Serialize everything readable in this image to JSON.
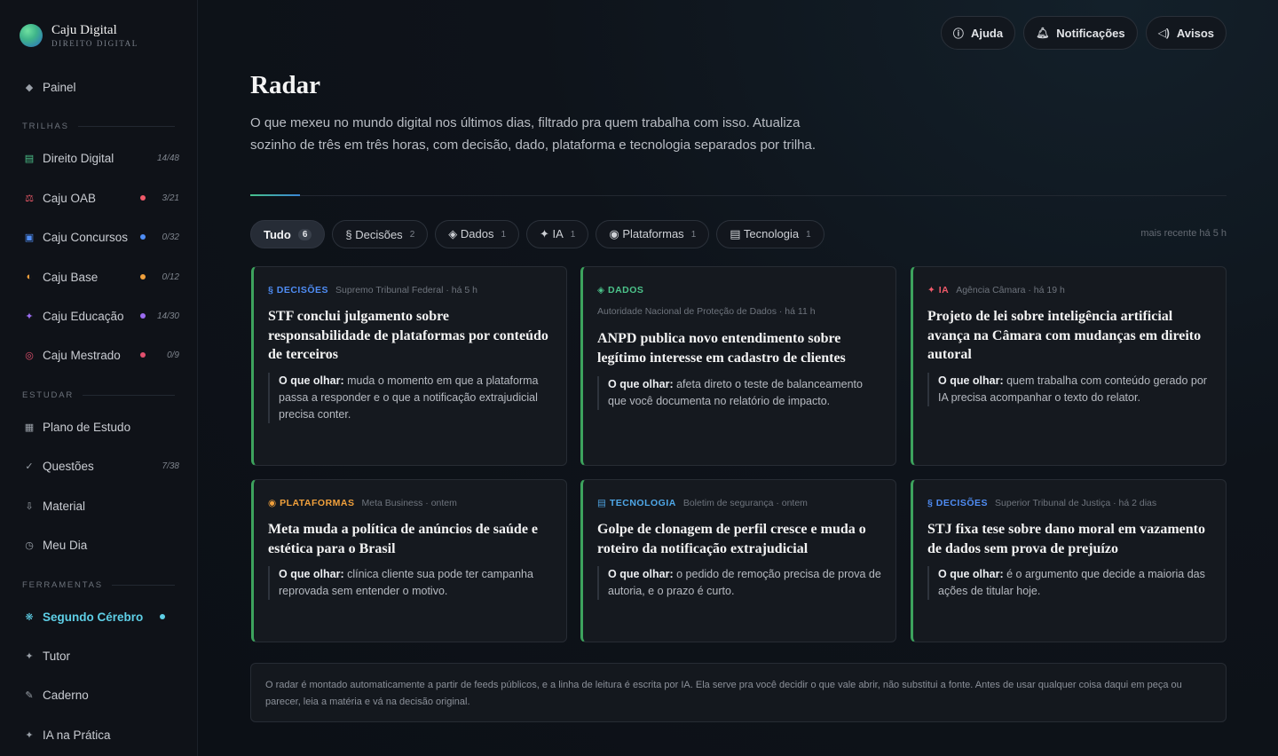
{
  "brand": {
    "name": "Caju Digital",
    "subtitle": "DIREITO DIGITAL"
  },
  "sidebar": {
    "painel": "Painel",
    "sections": [
      "TRILHAS",
      "ESTUDAR",
      "FERRAMENTAS"
    ],
    "trilhas": [
      {
        "label": "Direito Digital",
        "count": "14/48",
        "icon": "book-icon",
        "color": "#4cc38a"
      },
      {
        "label": "Caju OAB",
        "count": "3/21",
        "icon": "scales-icon",
        "color": "#f05a6a"
      },
      {
        "label": "Caju Concursos",
        "count": "0/32",
        "icon": "building-icon",
        "color": "#4f8df5"
      },
      {
        "label": "Caju Base",
        "count": "0/12",
        "icon": "half-circle-icon",
        "color": "#f0a03c"
      },
      {
        "label": "Caju Educação",
        "count": "14/30",
        "icon": "sparkle-icon",
        "color": "#9b6cf0"
      },
      {
        "label": "Caju Mestrado",
        "count": "0/9",
        "icon": "target-icon",
        "color": "#e2506e"
      }
    ],
    "estudar": [
      {
        "label": "Plano de Estudo",
        "count": ""
      },
      {
        "label": "Questões",
        "count": "7/38"
      },
      {
        "label": "Material",
        "count": ""
      },
      {
        "label": "Meu Dia",
        "count": ""
      }
    ],
    "ferramentas": [
      {
        "label": "Segundo Cérebro",
        "active": true
      },
      {
        "label": "Tutor"
      },
      {
        "label": "Caderno"
      },
      {
        "label": "IA na Prática"
      }
    ]
  },
  "topbar": {
    "help": "Ajuda",
    "notifications": "Notificações",
    "notices": "Avisos"
  },
  "page": {
    "title": "Radar",
    "description": "O que mexeu no mundo digital nos últimos dias, filtrado pra quem trabalha com isso. Atualiza sozinho de três em três horas, com decisão, dado, plataforma e tecnologia separados por trilha."
  },
  "filters": [
    {
      "label": "Tudo",
      "count": "6",
      "active": true
    },
    {
      "label": "§ Decisões",
      "count": "2"
    },
    {
      "label": "◈ Dados",
      "count": "1"
    },
    {
      "label": "✦ IA",
      "count": "1"
    },
    {
      "label": "◉ Plataformas",
      "count": "1"
    },
    {
      "label": "▤ Tecnologia",
      "count": "1"
    }
  ],
  "recent": "mais recente há 5 h",
  "cards": [
    {
      "tag": "§ DECISÕES",
      "tag_color": "#4f8df5",
      "source": "Supremo Tribunal Federal · há 5 h",
      "title": "STF conclui julgamento sobre responsabilidade de plataformas por conteúdo de terceiros",
      "look_label": "O que olhar:",
      "look": "muda o momento em que a plataforma passa a responder e o que a notificação extrajudicial precisa conter."
    },
    {
      "tag": "◈ DADOS",
      "tag_color": "#4cc38a",
      "source": "Autoridade Nacional de Proteção de Dados · há 11 h",
      "title": "ANPD publica novo entendimento sobre legítimo interesse em cadastro de clientes",
      "look_label": "O que olhar:",
      "look": "afeta direto o teste de balanceamento que você documenta no relatório de impacto."
    },
    {
      "tag": "✦ IA",
      "tag_color": "#f05a6a",
      "source": "Agência Câmara · há 19 h",
      "title": "Projeto de lei sobre inteligência artificial avança na Câmara com mudanças em direito autoral",
      "look_label": "O que olhar:",
      "look": "quem trabalha com conteúdo gerado por IA precisa acompanhar o texto do relator."
    },
    {
      "tag": "◉ PLATAFORMAS",
      "tag_color": "#f0a03c",
      "source": "Meta Business · ontem",
      "title": "Meta muda a política de anúncios de saúde e estética para o Brasil",
      "look_label": "O que olhar:",
      "look": "clínica cliente sua pode ter campanha reprovada sem entender o motivo."
    },
    {
      "tag": "▤ TECNOLOGIA",
      "tag_color": "#4fa8e8",
      "source": "Boletim de segurança · ontem",
      "title": "Golpe de clonagem de perfil cresce e muda o roteiro da notificação extrajudicial",
      "look_label": "O que olhar:",
      "look": "o pedido de remoção precisa de prova de autoria, e o prazo é curto."
    },
    {
      "tag": "§ DECISÕES",
      "tag_color": "#4f8df5",
      "source": "Superior Tribunal de Justiça · há 2 dias",
      "title": "STJ fixa tese sobre dano moral em vazamento de dados sem prova de prejuízo",
      "look_label": "O que olhar:",
      "look": "é o argumento que decide a maioria das ações de titular hoje."
    }
  ],
  "footer_note": "O radar é montado automaticamente a partir de feeds públicos, e a linha de leitura é escrita por IA. Ela serve pra você decidir o que vale abrir, não substitui a fonte. Antes de usar qualquer coisa daqui em peça ou parecer, leia a matéria e vá na decisão original."
}
